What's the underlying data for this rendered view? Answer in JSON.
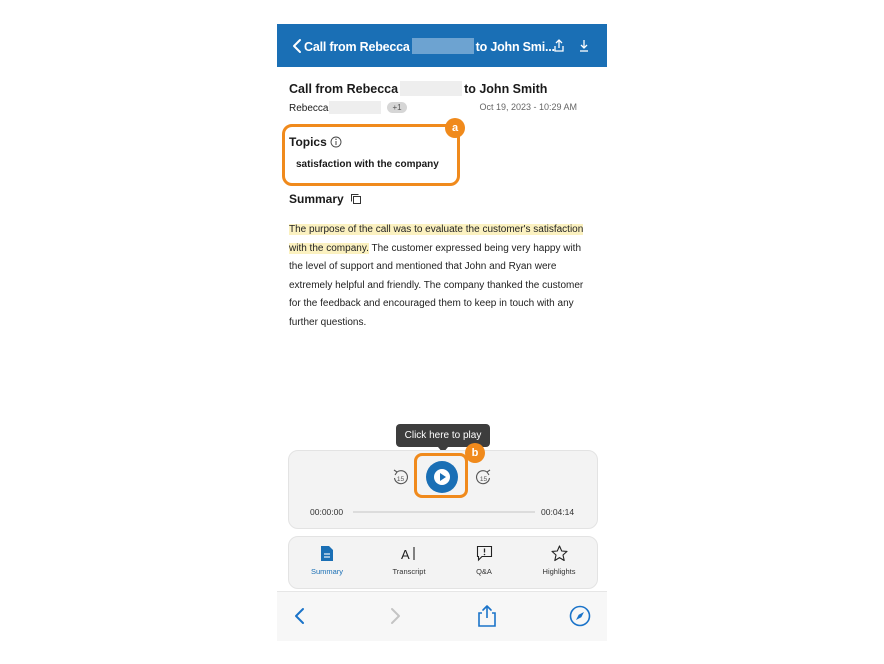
{
  "header": {
    "title_start": "Call from Rebecca",
    "title_end": "to John Smi..."
  },
  "call": {
    "title_start": "Call from Rebecca",
    "title_end": "to John Smith",
    "participant": "Rebecca",
    "extra_count": "+1",
    "datetime": "Oct 19, 2023 - 10:29 AM"
  },
  "topics": {
    "label": "Topics",
    "items": [
      "satisfaction with the company"
    ]
  },
  "summary": {
    "label": "Summary",
    "highlighted": "The purpose of the call was to evaluate the customer's satisfaction with the company.",
    "body": " The customer expressed being very happy with the level of support and mentioned that John and Ryan were extremely helpful and friendly. The company thanked the customer for the feedback and encouraged them to keep in touch with any further questions."
  },
  "player": {
    "tooltip": "Click here to play",
    "current_time": "00:00:00",
    "duration": "00:04:14",
    "progress": 0,
    "skip_back_seconds": "15",
    "skip_forward_seconds": "15"
  },
  "markers": {
    "a": "a",
    "b": "b"
  },
  "tabs": [
    {
      "label": "Summary",
      "icon": "document-icon",
      "active": true
    },
    {
      "label": "Transcript",
      "icon": "text-cursor-icon",
      "active": false
    },
    {
      "label": "Q&A",
      "icon": "chat-alert-icon",
      "active": false
    },
    {
      "label": "Highlights",
      "icon": "star-icon",
      "active": false
    }
  ],
  "colors": {
    "brand_blue": "#1a6fb5",
    "callout_orange": "#f08a1c",
    "highlight_yellow": "#fbf1c0"
  }
}
